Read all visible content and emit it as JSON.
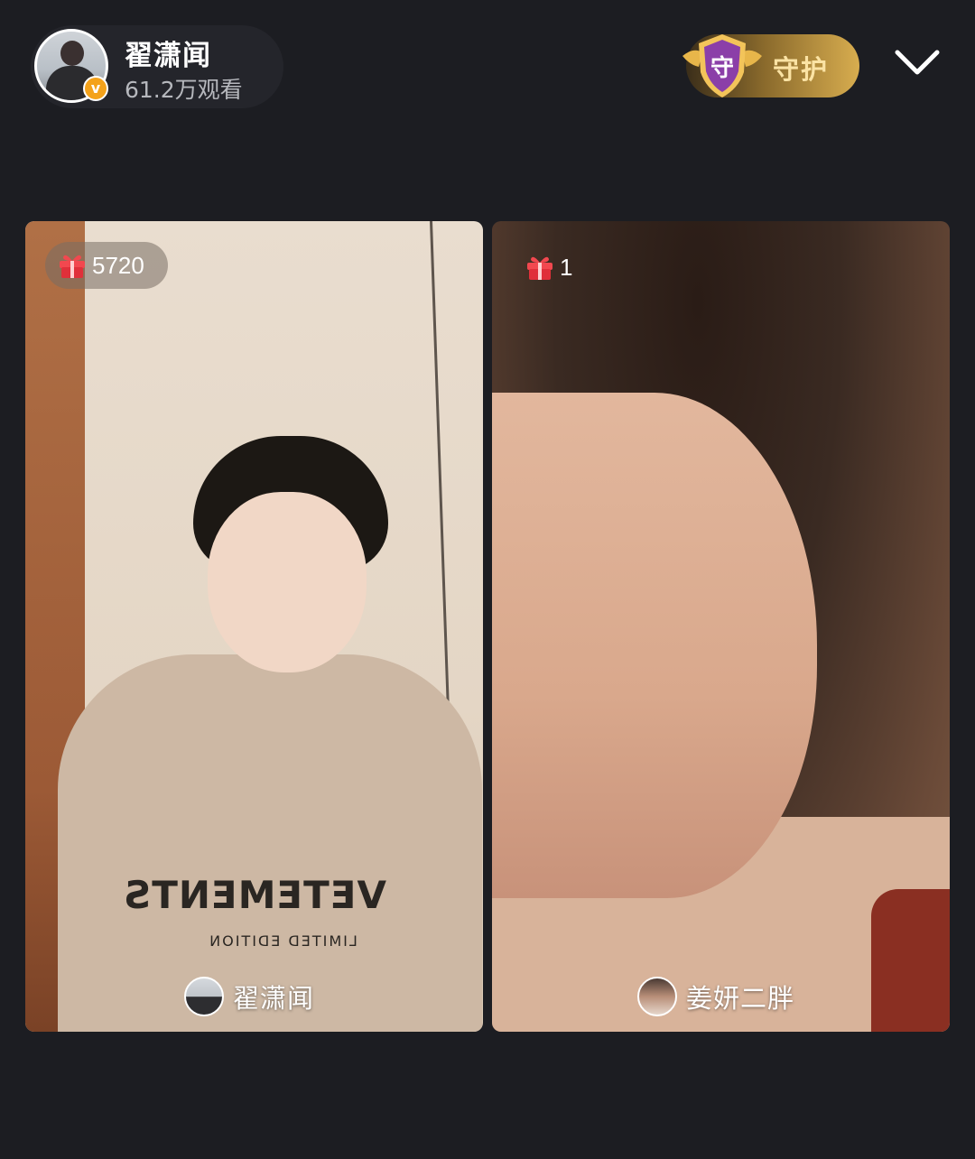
{
  "header": {
    "host_name": "翟潇闻",
    "viewers": "61.2万观看",
    "verified_mark": "v",
    "guard_label": "守护",
    "guard_shield_char": "守",
    "collapse_icon": "chevron-down-icon"
  },
  "panels": [
    {
      "gift_count": "5720",
      "gift_icon": "gift-icon",
      "name": "翟潇闻",
      "shirt_text": "VETEMENTS",
      "shirt_subtext": "LIMITED EDITION"
    },
    {
      "gift_count": "1",
      "gift_icon": "gift-icon",
      "name": "姜妍二胖"
    }
  ],
  "colors": {
    "background": "#1c1d22",
    "guard_gold": "#d8ad4f",
    "verify_orange": "#f4a21a",
    "gift_red": "#e0303a"
  }
}
